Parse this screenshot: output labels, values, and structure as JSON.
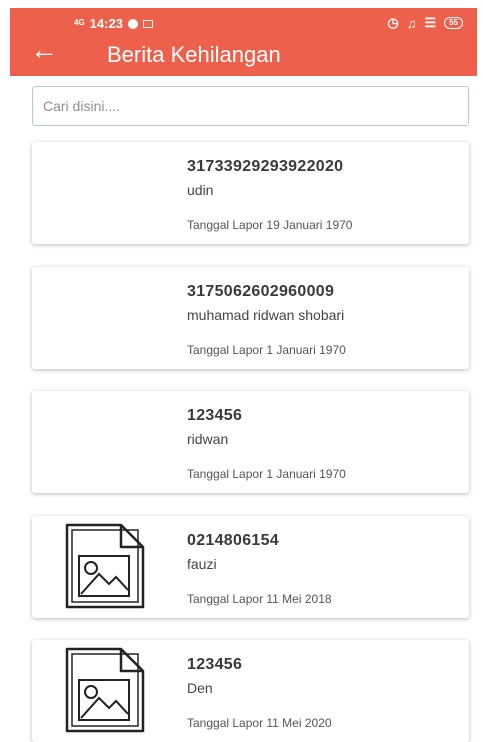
{
  "status": {
    "network": "4G",
    "time": "14:23",
    "battery": "55"
  },
  "appbar": {
    "back_icon": "arrow-left-icon",
    "title": "Berita Kehilangan",
    "color": "#ec604c"
  },
  "search": {
    "placeholder": "Cari disini...."
  },
  "items": [
    {
      "id": "31733929293922020",
      "name": "udin",
      "date": "Tanggal Lapor 19 Januari 1970",
      "has_image_icon": false
    },
    {
      "id": "3175062602960009",
      "name": "muhamad ridwan shobari",
      "date": "Tanggal Lapor 1 Januari 1970",
      "has_image_icon": false
    },
    {
      "id": "123456",
      "name": "ridwan",
      "date": "Tanggal Lapor 1 Januari 1970",
      "has_image_icon": false
    },
    {
      "id": "0214806154",
      "name": "fauzi",
      "date": "Tanggal Lapor 11 Mei 2018",
      "has_image_icon": true
    },
    {
      "id": "123456",
      "name": "Den",
      "date": "Tanggal Lapor 11 Mei 2020",
      "has_image_icon": true
    }
  ]
}
